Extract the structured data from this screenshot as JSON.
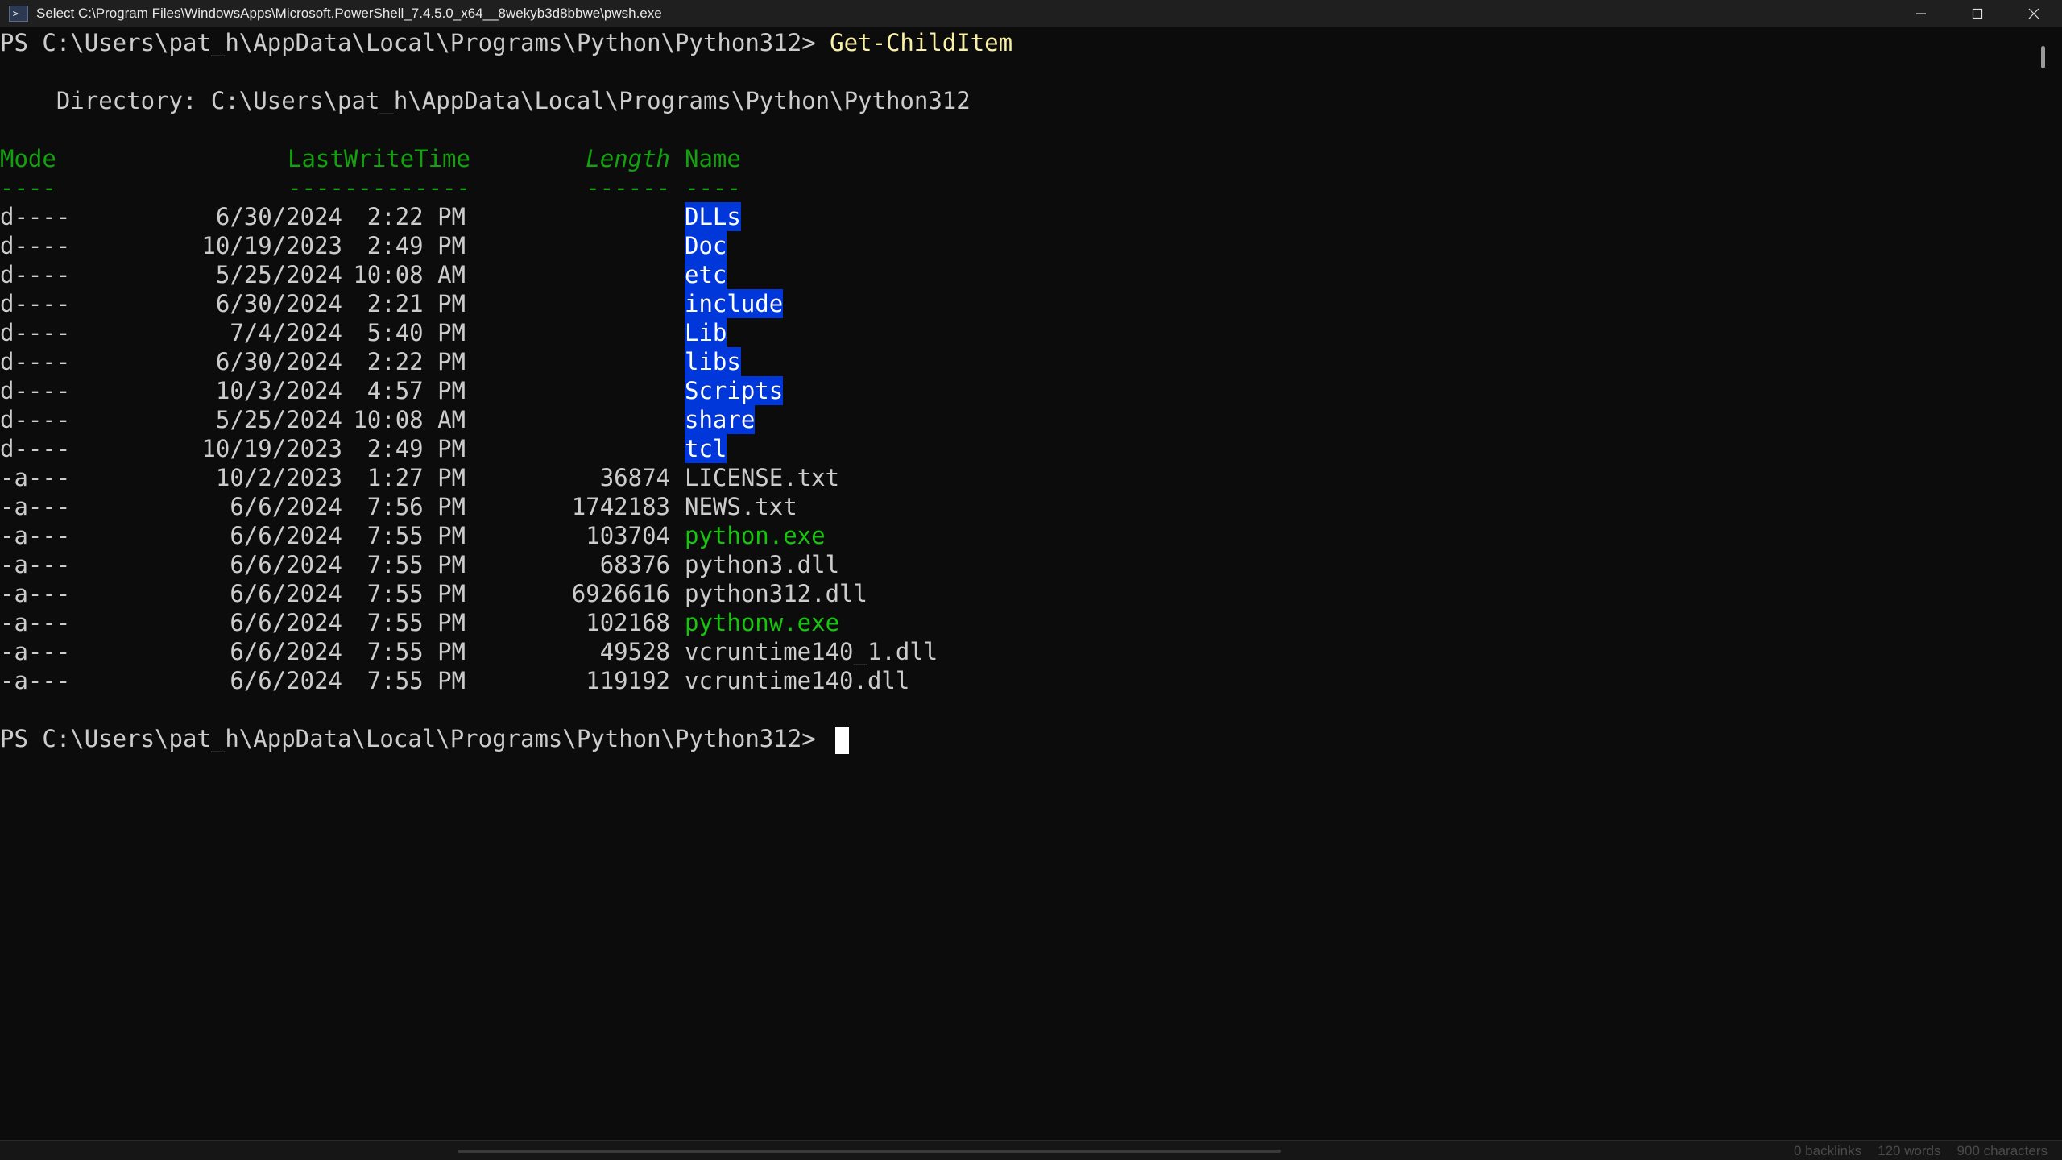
{
  "window": {
    "title": "Select C:\\Program Files\\WindowsApps\\Microsoft.PowerShell_7.4.5.0_x64__8wekyb3d8bbwe\\pwsh.exe",
    "icon": "powershell-icon",
    "controls": [
      "minimize-icon",
      "maximize-icon",
      "close-icon"
    ]
  },
  "terminal": {
    "prompt": "PS C:\\Users\\pat_h\\AppData\\Local\\Programs\\Python\\Python312> ",
    "command": "Get-ChildItem",
    "directory_line": "    Directory: C:\\Users\\pat_h\\AppData\\Local\\Programs\\Python\\Python312",
    "headers": {
      "mode": "Mode",
      "lastwritetime": "LastWriteTime",
      "length": "Length",
      "name": "Name"
    },
    "underlines": {
      "mode": "----",
      "lastwritetime": "-------------",
      "length": "------",
      "name": "----"
    },
    "entries": [
      {
        "mode": "d----",
        "date": "6/30/2024",
        "time": "2:22 PM",
        "length": "",
        "name": "DLLs",
        "kind": "dir"
      },
      {
        "mode": "d----",
        "date": "10/19/2023",
        "time": "2:49 PM",
        "length": "",
        "name": "Doc",
        "kind": "dir"
      },
      {
        "mode": "d----",
        "date": "5/25/2024",
        "time": "10:08 AM",
        "length": "",
        "name": "etc",
        "kind": "dir"
      },
      {
        "mode": "d----",
        "date": "6/30/2024",
        "time": "2:21 PM",
        "length": "",
        "name": "include",
        "kind": "dir"
      },
      {
        "mode": "d----",
        "date": "7/4/2024",
        "time": "5:40 PM",
        "length": "",
        "name": "Lib",
        "kind": "dir"
      },
      {
        "mode": "d----",
        "date": "6/30/2024",
        "time": "2:22 PM",
        "length": "",
        "name": "libs",
        "kind": "dir"
      },
      {
        "mode": "d----",
        "date": "10/3/2024",
        "time": "4:57 PM",
        "length": "",
        "name": "Scripts",
        "kind": "dir"
      },
      {
        "mode": "d----",
        "date": "5/25/2024",
        "time": "10:08 AM",
        "length": "",
        "name": "share",
        "kind": "dir"
      },
      {
        "mode": "d----",
        "date": "10/19/2023",
        "time": "2:49 PM",
        "length": "",
        "name": "tcl",
        "kind": "dir"
      },
      {
        "mode": "-a---",
        "date": "10/2/2023",
        "time": "1:27 PM",
        "length": "36874",
        "name": "LICENSE.txt",
        "kind": "file"
      },
      {
        "mode": "-a---",
        "date": "6/6/2024",
        "time": "7:56 PM",
        "length": "1742183",
        "name": "NEWS.txt",
        "kind": "file"
      },
      {
        "mode": "-a---",
        "date": "6/6/2024",
        "time": "7:55 PM",
        "length": "103704",
        "name": "python.exe",
        "kind": "exe"
      },
      {
        "mode": "-a---",
        "date": "6/6/2024",
        "time": "7:55 PM",
        "length": "68376",
        "name": "python3.dll",
        "kind": "file"
      },
      {
        "mode": "-a---",
        "date": "6/6/2024",
        "time": "7:55 PM",
        "length": "6926616",
        "name": "python312.dll",
        "kind": "file"
      },
      {
        "mode": "-a---",
        "date": "6/6/2024",
        "time": "7:55 PM",
        "length": "102168",
        "name": "pythonw.exe",
        "kind": "exe"
      },
      {
        "mode": "-a---",
        "date": "6/6/2024",
        "time": "7:55 PM",
        "length": "49528",
        "name": "vcruntime140_1.dll",
        "kind": "file"
      },
      {
        "mode": "-a---",
        "date": "6/6/2024",
        "time": "7:55 PM",
        "length": "119192",
        "name": "vcruntime140.dll",
        "kind": "file"
      }
    ]
  },
  "status_bar": {
    "backlinks": "0 backlinks",
    "words": "120 words",
    "characters": "900 characters"
  },
  "colors": {
    "background": "#0c0c0c",
    "text": "#cccccc",
    "header_green": "#13a10e",
    "command_yellow": "#f9f1a5",
    "exe_green": "#16c60c",
    "dir_highlight": "#0037da"
  }
}
